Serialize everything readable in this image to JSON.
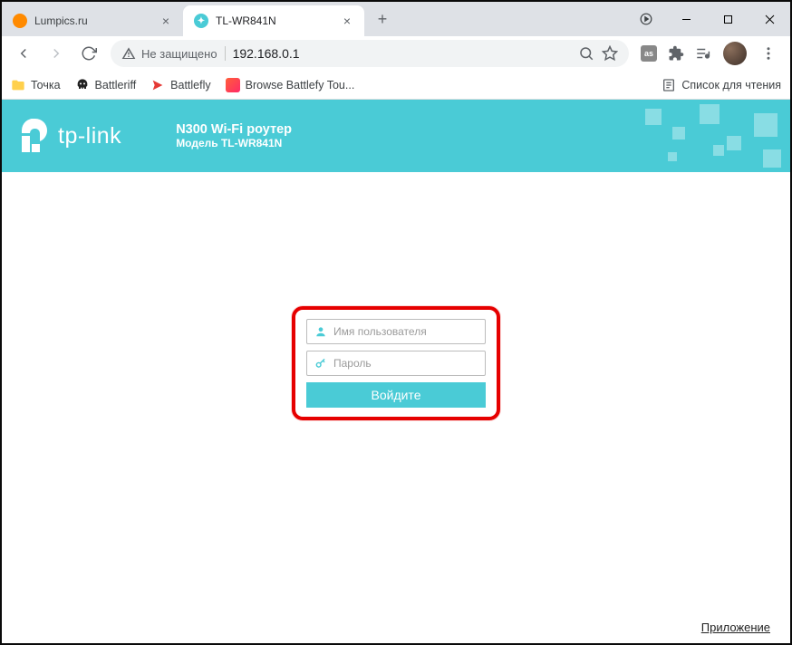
{
  "tabs": [
    {
      "title": "Lumpics.ru",
      "favicon_color": "#ff8a00",
      "active": false
    },
    {
      "title": "TL-WR841N",
      "favicon_color": "#4acbd6",
      "active": true
    }
  ],
  "address": {
    "insecure_label": "Не защищено",
    "url": "192.168.0.1"
  },
  "bookmarks": [
    {
      "label": "Точка",
      "icon": "folder"
    },
    {
      "label": "Battleriff",
      "icon": "skull"
    },
    {
      "label": "Battlefly",
      "icon": "red-arrow"
    },
    {
      "label": "Browse Battlefy Tou...",
      "icon": "grid"
    }
  ],
  "reading_list_label": "Список для чтения",
  "tp_header": {
    "brand": "tp-link",
    "title": "N300 Wi-Fi роутер",
    "model": "Модель TL-WR841N"
  },
  "login": {
    "username_placeholder": "Имя пользователя",
    "password_placeholder": "Пароль",
    "submit_label": "Войдите"
  },
  "app_link": "Приложение",
  "colors": {
    "accent": "#4acbd6",
    "highlight_border": "#e60000"
  }
}
